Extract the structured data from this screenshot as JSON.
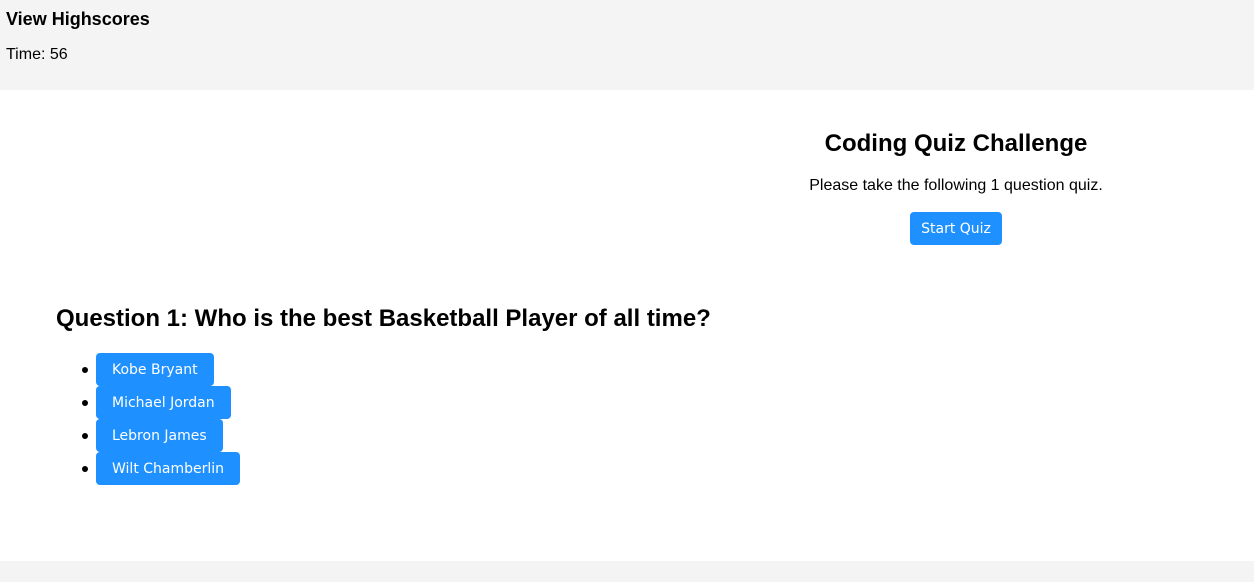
{
  "header": {
    "highscores_label": "View Highscores",
    "timer_text": "Time: 56"
  },
  "intro": {
    "title": "Coding Quiz Challenge",
    "description": "Please take the following 1 question quiz.",
    "start_label": "Start Quiz"
  },
  "question": {
    "title": "Question 1: Who is the best Basketball Player of all time?",
    "answers": [
      {
        "label": "Kobe Bryant"
      },
      {
        "label": "Michael Jordan"
      },
      {
        "label": "Lebron James"
      },
      {
        "label": "Wilt Chamberlin"
      }
    ]
  },
  "colors": {
    "button_bg": "#1e90ff",
    "button_text": "#ffffff",
    "header_bg": "#f4f4f4",
    "main_bg": "#ffffff"
  }
}
